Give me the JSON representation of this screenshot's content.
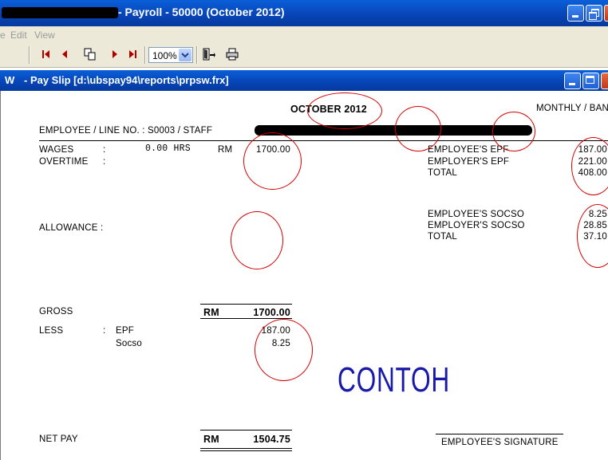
{
  "outer_window": {
    "title": "- Payroll - 50000 (October 2012)"
  },
  "menu": {
    "partial_item": "e",
    "edit": "Edit",
    "view": "View"
  },
  "toolbar": {
    "zoom_value": "100%",
    "icons": [
      "first-page-icon",
      "prev-page-icon",
      "copy-icon",
      "next-page-icon",
      "last-page-icon",
      "exit-icon",
      "printer-icon"
    ]
  },
  "inner_window": {
    "prefix": "W",
    "title": "- Pay Slip [d:\\ubspay94\\reports\\prpsw.frx]"
  },
  "report": {
    "period": "OCTOBER 2012",
    "pay_type": "MONTHLY / BAN",
    "employee_label": "EMPLOYEE / LINE NO. : S0003  / STAFF",
    "wages_label": "WAGES",
    "wages_colon": ":",
    "hours": "0.00 HRS",
    "currency": "RM",
    "wages_amount": "1700.00",
    "overtime_label": "OVERTIME",
    "overtime_colon": ":",
    "allowance_label": "ALLOWANCE :",
    "epf": {
      "employee_label": "EMPLOYEE'S EPF",
      "employee_value": "187.00",
      "employer_label": "EMPLOYER'S EPF",
      "employer_value": "221.00",
      "total_label": "TOTAL",
      "total_value": "408.00"
    },
    "socso": {
      "employee_label": "EMPLOYEE'S SOCSO",
      "employee_value": "8.25",
      "employer_label": "EMPLOYER'S SOCSO",
      "employer_value": "28.85",
      "total_label": "TOTAL",
      "total_value": "37.10"
    },
    "watermark": "CONTOH",
    "gross_label": "GROSS",
    "gross_currency": "RM",
    "gross_amount": "1700.00",
    "less_label": "LESS",
    "less_colon": ":",
    "less_items": [
      {
        "label": "EPF",
        "value": "187.00"
      },
      {
        "label": "Socso",
        "value": "8.25"
      }
    ],
    "net_pay_label": "NET PAY",
    "net_currency": "RM",
    "net_amount": "1504.75",
    "signature_label": "EMPLOYEE'S SIGNATURE"
  },
  "colors": {
    "title_bar": "#0745b8",
    "annotation_circle": "#d40000",
    "watermark": "#1a1aaa"
  }
}
